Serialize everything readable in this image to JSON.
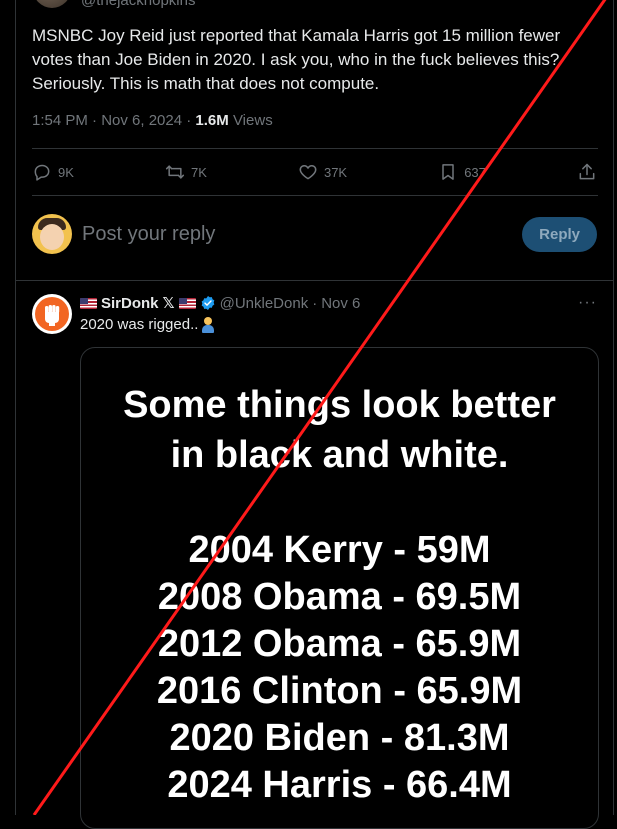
{
  "original_tweet": {
    "handle": "@thejackhopkins",
    "text": "MSNBC Joy Reid just reported that Kamala Harris got 15 million fewer votes than Joe Biden in 2020. I ask you, who in the fuck believes this? Seriously. This is math that does not compute.",
    "time": "1:54 PM · Nov 6, 2024 · ",
    "views_count": "1.6M",
    "views_label": " Views",
    "stats": {
      "replies": "9K",
      "reposts": "7K",
      "likes": "37K",
      "bookmarks": "637"
    }
  },
  "reply_box": {
    "placeholder": "Post your reply",
    "button": "Reply"
  },
  "reply": {
    "name": "SirDonk",
    "x_mark": "𝕏",
    "handle": "@UnkleDonk",
    "separator": "·",
    "date": "Nov 6",
    "more": "···",
    "text": "2020 was rigged..",
    "media_lines": [
      "Some things look better",
      "in black and white.",
      "2004 Kerry - 59M",
      "2008 Obama - 69.5M",
      "2012 Obama - 65.9M",
      "2016 Clinton - 65.9M",
      "2020 Biden - 81.3M",
      "2024 Harris - 66.4M"
    ]
  },
  "colors": {
    "background": "#000000",
    "text": "#e7e9ea",
    "muted": "#71767b",
    "border": "#2f3336",
    "reply_button": "#1d4f74",
    "verified": "#1d9bf0",
    "slash_line": "#ff1a1a"
  }
}
